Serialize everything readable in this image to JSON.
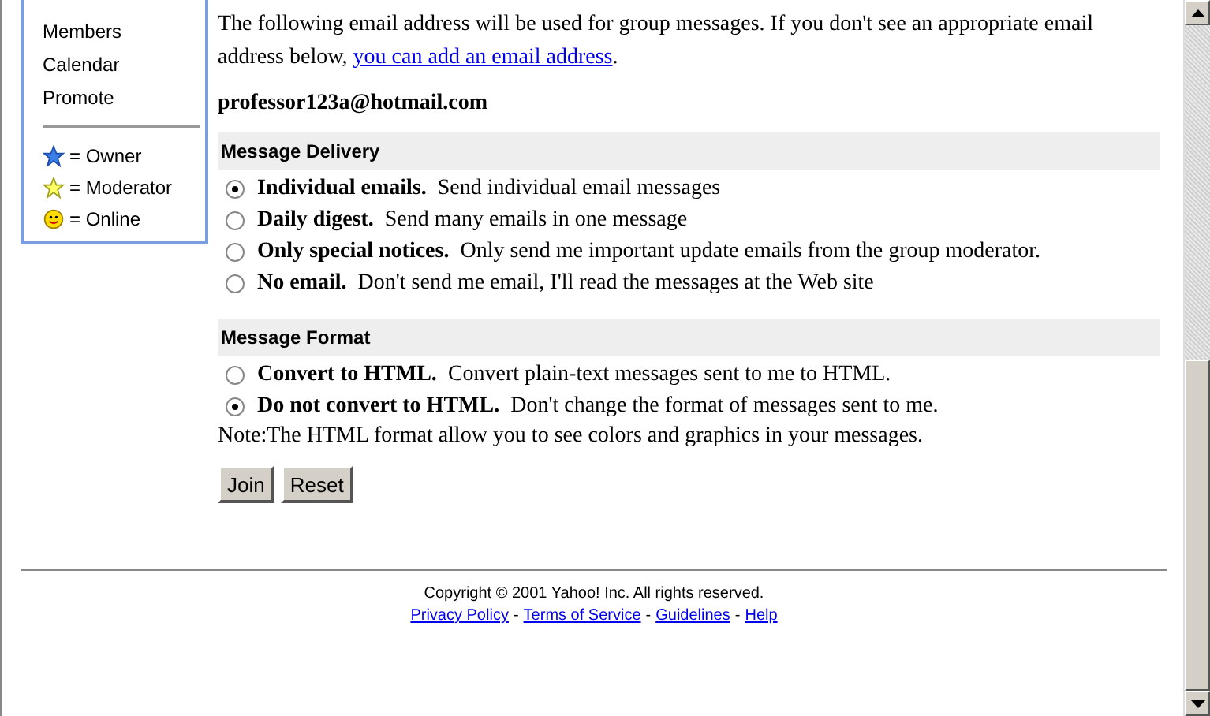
{
  "sidebar": {
    "items": [
      "Members",
      "Calendar",
      "Promote"
    ],
    "legend": [
      {
        "kind": "owner",
        "label": "= Owner"
      },
      {
        "kind": "moderator",
        "label": "= Moderator"
      },
      {
        "kind": "online",
        "label": "= Online"
      }
    ]
  },
  "intro": {
    "text": "The following email address will be used for group messages. If you don't see an appropriate email address below, ",
    "link": "you can add an email address",
    "end": "."
  },
  "email": "professor123a@hotmail.com",
  "sections": [
    {
      "title": "Message Delivery",
      "options": [
        {
          "label": "Individual emails.",
          "description": "Send individual email messages",
          "selected": true
        },
        {
          "label": "Daily digest.",
          "description": "Send many emails in one message",
          "selected": false
        },
        {
          "label": "Only special notices.",
          "description": "Only send me important update emails from the group moderator.",
          "selected": false
        },
        {
          "label": "No email.",
          "description": "Don't send me email, I'll read the messages at the Web site",
          "selected": false
        }
      ]
    },
    {
      "title": "Message Format",
      "options": [
        {
          "label": "Convert to HTML.",
          "description": "Convert plain-text messages sent to me to HTML.",
          "selected": false
        },
        {
          "label": "Do not convert to HTML.",
          "description": "Don't change the format of messages sent to me.",
          "selected": true
        }
      ]
    }
  ],
  "note": "Note:The HTML format allow you to see colors and graphics in your messages.",
  "buttons": [
    "Join",
    "Reset"
  ],
  "footer": {
    "copyright": "Copyright © 2001 Yahoo! Inc. All rights reserved.",
    "links": [
      "Privacy Policy",
      "Terms of Service",
      "Guidelines",
      "Help"
    ],
    "separator": "-"
  }
}
